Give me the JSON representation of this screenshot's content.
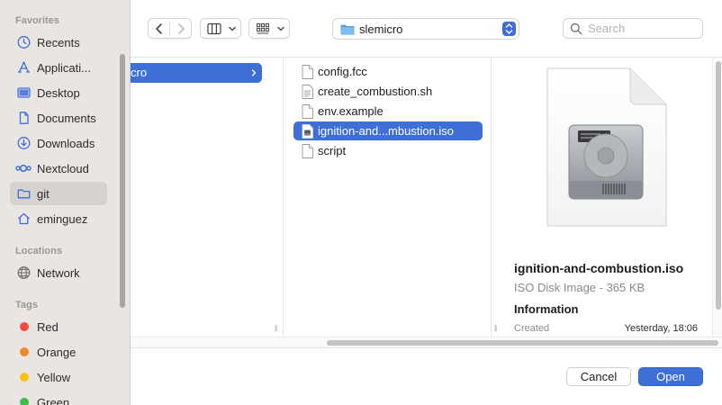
{
  "sidebar": {
    "favorites_heading": "Favorites",
    "favorites": [
      {
        "label": "Recents",
        "icon": "clock-icon"
      },
      {
        "label": "Applicati...",
        "icon": "applications-icon"
      },
      {
        "label": "Desktop",
        "icon": "desktop-icon"
      },
      {
        "label": "Documents",
        "icon": "document-icon"
      },
      {
        "label": "Downloads",
        "icon": "download-icon"
      },
      {
        "label": "Nextcloud",
        "icon": "nextcloud-icon"
      },
      {
        "label": "git",
        "icon": "folder-icon",
        "selected": true
      },
      {
        "label": "eminguez",
        "icon": "home-icon"
      }
    ],
    "locations_heading": "Locations",
    "locations": [
      {
        "label": "Network",
        "icon": "globe-icon"
      }
    ],
    "tags_heading": "Tags",
    "tags": [
      {
        "label": "Red",
        "color": "#ee4b43"
      },
      {
        "label": "Orange",
        "color": "#f0892b"
      },
      {
        "label": "Yellow",
        "color": "#f3c318"
      },
      {
        "label": "Green",
        "color": "#3fbd4a"
      }
    ]
  },
  "toolbar": {
    "back_icon": "chevron-left-icon",
    "forward_icon": "chevron-right-icon",
    "view_icon": "columns-view-icon",
    "group_icon": "grid-group-icon",
    "path_label": "slemicro",
    "search_placeholder": "Search"
  },
  "browser": {
    "column1_selected": "cro",
    "files": [
      {
        "name": "config.fcc",
        "icon": "file-icon"
      },
      {
        "name": "create_combustion.sh",
        "icon": "script-file-icon"
      },
      {
        "name": "env.example",
        "icon": "file-icon"
      },
      {
        "name": "ignition-and...mbustion.iso",
        "icon": "disk-image-file-icon",
        "selected": true
      },
      {
        "name": "script",
        "icon": "file-icon"
      }
    ]
  },
  "preview": {
    "name": "ignition-and-combustion.iso",
    "kind": "ISO Disk Image - 365 KB",
    "info_heading": "Information",
    "created_label": "Created",
    "created_value": "Yesterday, 18:06"
  },
  "buttons": {
    "cancel": "Cancel",
    "open": "Open"
  },
  "colors": {
    "accent": "#3d6fd6",
    "sidebar_bg": "#e9e5e3"
  }
}
